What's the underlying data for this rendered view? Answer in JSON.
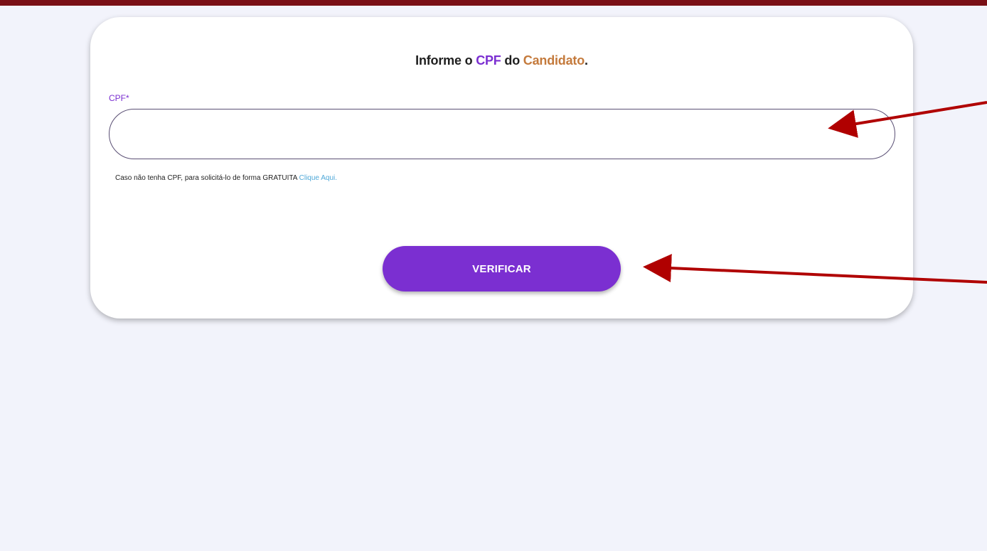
{
  "form": {
    "heading_prefix": "Informe o ",
    "heading_cpf": "CPF",
    "heading_middle": " do ",
    "heading_candidate": "Candidato",
    "heading_suffix": ".",
    "cpf_label": "CPF*",
    "cpf_value": "",
    "helper_text": "Caso não tenha CPF, para solicitá-lo de forma GRATUITA ",
    "helper_link": "Clique Aqui.",
    "verify_label": "VERIFICAR"
  },
  "colors": {
    "top_bar": "#7a1016",
    "accent": "#7b2fd1",
    "candidate": "#c47a3c",
    "link": "#4fa8d8",
    "annotation_arrow": "#b00000",
    "background": "#f2f3fb"
  }
}
